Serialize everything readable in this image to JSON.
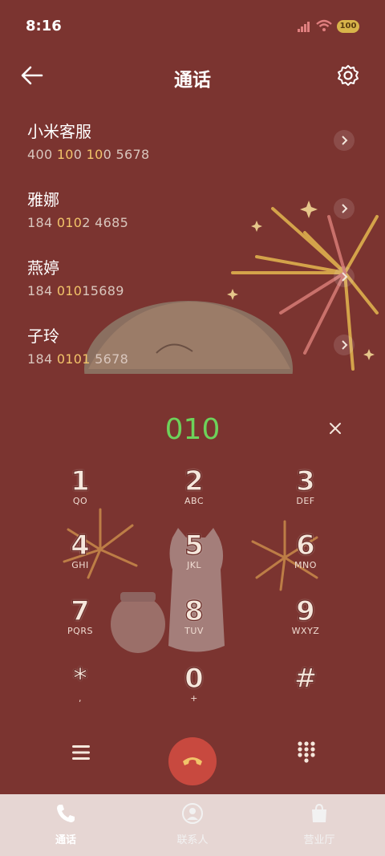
{
  "status": {
    "time": "8:16",
    "battery": "100"
  },
  "header": {
    "title": "通话"
  },
  "calls": [
    {
      "name": "小米客服",
      "number_parts": [
        "400 ",
        "10",
        "0 ",
        "10",
        "0 5678"
      ]
    },
    {
      "name": "雅娜",
      "number_parts": [
        "184 ",
        "010",
        "2 4685",
        "",
        ""
      ]
    },
    {
      "name": "燕婷",
      "number_parts": [
        "184 ",
        "010",
        "15689",
        "",
        ""
      ]
    },
    {
      "name": "子玲",
      "number_parts": [
        "184 ",
        "0101",
        " 5678",
        "",
        ""
      ]
    }
  ],
  "dialer": {
    "input": "010"
  },
  "keys": [
    {
      "digit": "1",
      "letters": "QO"
    },
    {
      "digit": "2",
      "letters": "ABC"
    },
    {
      "digit": "3",
      "letters": "DEF"
    },
    {
      "digit": "4",
      "letters": "GHI"
    },
    {
      "digit": "5",
      "letters": "JKL"
    },
    {
      "digit": "6",
      "letters": "MNO"
    },
    {
      "digit": "7",
      "letters": "PQRS"
    },
    {
      "digit": "8",
      "letters": "TUV"
    },
    {
      "digit": "9",
      "letters": "WXYZ"
    },
    {
      "digit": "*",
      "letters": ","
    },
    {
      "digit": "0",
      "letters": "+"
    },
    {
      "digit": "#",
      "letters": ""
    }
  ],
  "tabs": [
    {
      "label": "通话",
      "color": "#ffffff"
    },
    {
      "label": "联系人",
      "color": "#f2f2f2"
    },
    {
      "label": "营业厅",
      "color": "#f2f2f2"
    }
  ],
  "colors": {
    "background": "#7b3430",
    "dialed": "#6dd25a",
    "call_button": "#c8493f",
    "highlight": "#f2c46a"
  }
}
